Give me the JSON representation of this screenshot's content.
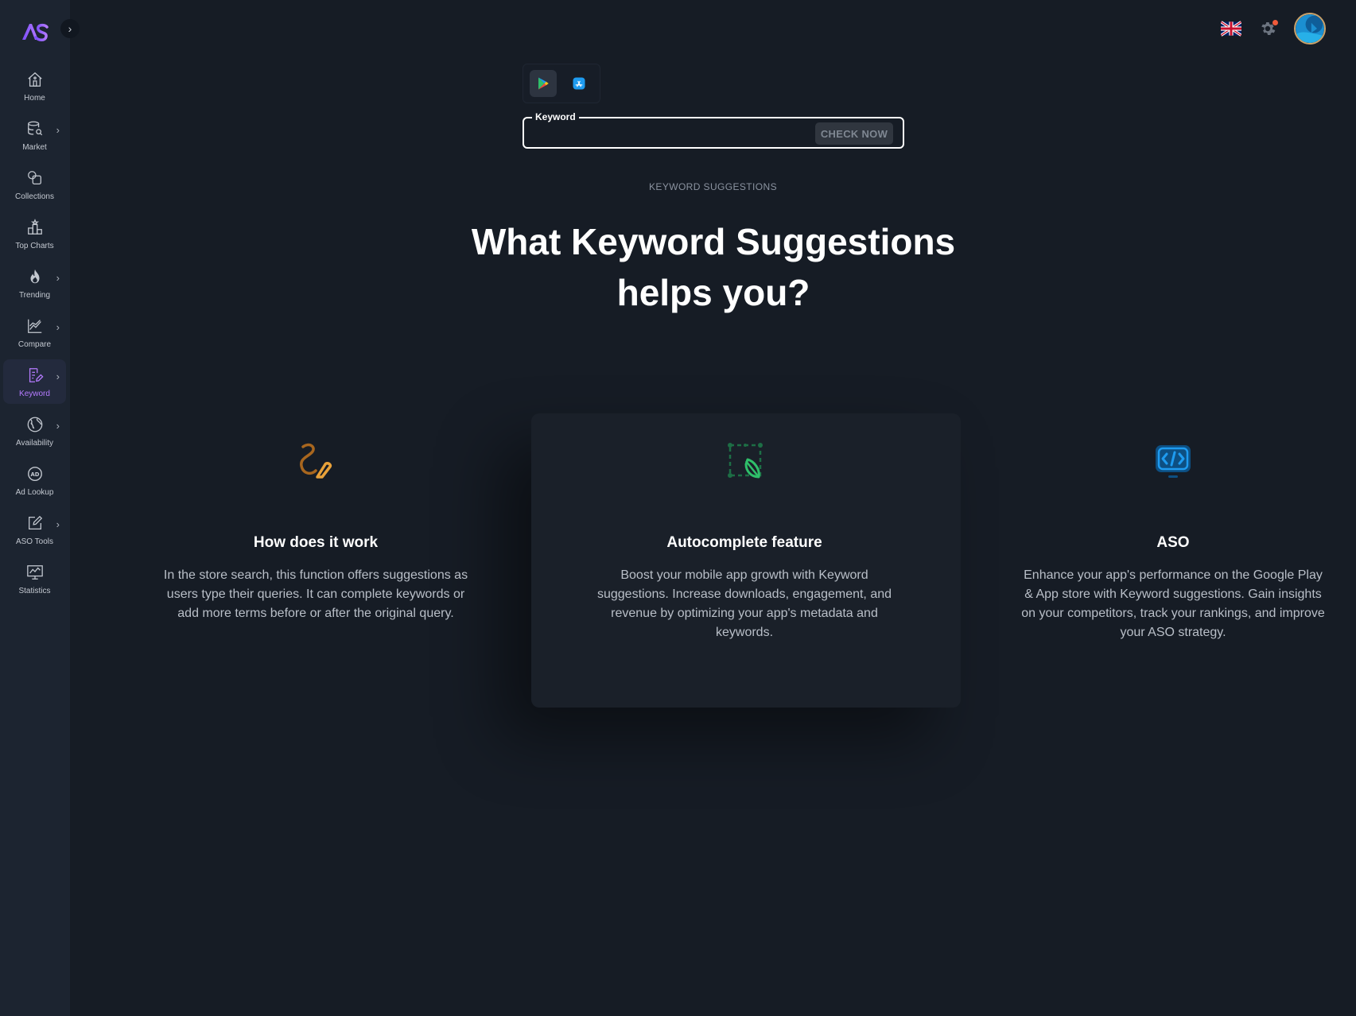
{
  "sidebar": {
    "logo_text": "AS",
    "items": [
      {
        "label": "Home",
        "icon": "home-icon",
        "has_submenu": false
      },
      {
        "label": "Market",
        "icon": "market-icon",
        "has_submenu": true
      },
      {
        "label": "Collections",
        "icon": "collections-icon",
        "has_submenu": false
      },
      {
        "label": "Top Charts",
        "icon": "top-charts-icon",
        "has_submenu": false
      },
      {
        "label": "Trending",
        "icon": "flame-icon",
        "has_submenu": true
      },
      {
        "label": "Compare",
        "icon": "chart-line-icon",
        "has_submenu": true
      },
      {
        "label": "Keyword",
        "icon": "keyword-icon",
        "has_submenu": true,
        "active": true
      },
      {
        "label": "Availability",
        "icon": "globe-icon",
        "has_submenu": true
      },
      {
        "label": "Ad Lookup",
        "icon": "ad-icon",
        "has_submenu": false
      },
      {
        "label": "ASO Tools",
        "icon": "edit-icon",
        "has_submenu": true
      },
      {
        "label": "Statistics",
        "icon": "statistics-icon",
        "has_submenu": false
      }
    ]
  },
  "header": {
    "language": "en-GB"
  },
  "store_toggle": {
    "options": [
      "Google Play",
      "App Store"
    ],
    "selected": "Google Play"
  },
  "search": {
    "legend": "Keyword",
    "value": "",
    "button_label": "CHECK NOW"
  },
  "section": {
    "tag": "KEYWORD SUGGESTIONS",
    "headline_line1": "What Keyword Suggestions",
    "headline_line2": "helps you?"
  },
  "features": [
    {
      "title": "How does it work",
      "description": "In the store search, this function offers suggestions as users type their queries. It can complete keywords or add more terms before or after the original query.",
      "icon": "swirl-icon",
      "color": "#e8a13a"
    },
    {
      "title": "Autocomplete feature",
      "description": "Boost your mobile app growth with Keyword suggestions. Increase downloads, engagement, and revenue by optimizing your app's metadata and keywords.",
      "icon": "select-pen-icon",
      "color": "#2fbf6a"
    },
    {
      "title": "ASO",
      "description": "Enhance your app's performance on the Google Play & App store with Keyword suggestions. Gain insights on your competitors, track your rankings, and improve your ASO strategy.",
      "icon": "code-monitor-icon",
      "color": "#1e9bf0"
    }
  ],
  "colors": {
    "background": "#161c25",
    "sidebar": "#1c2430",
    "accent": "#b57bff",
    "notification": "#f05a3a"
  }
}
